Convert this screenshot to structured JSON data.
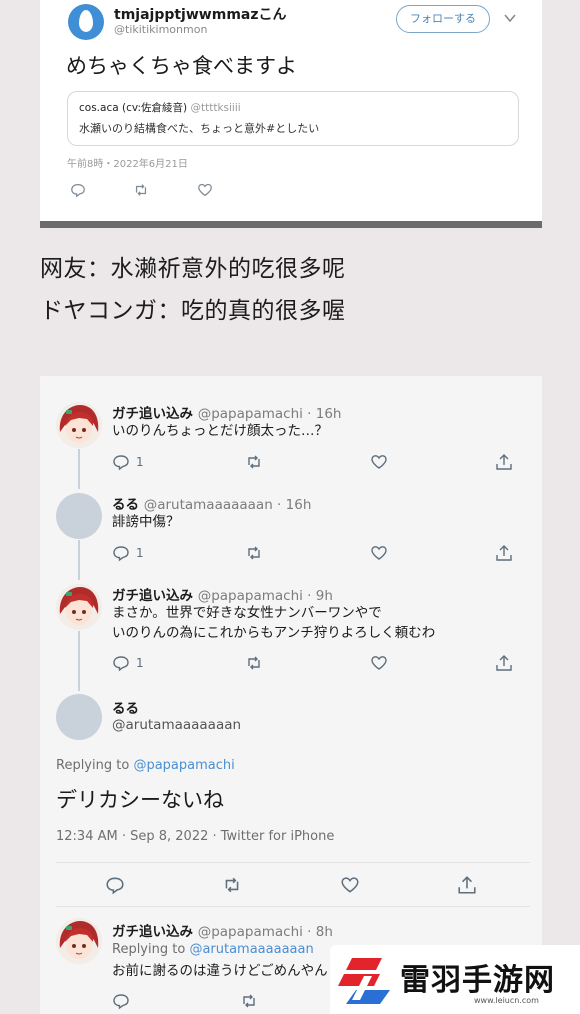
{
  "top_tweet": {
    "name": "tmjajpptjwwmmazこん",
    "handle": "@tikitikimonmon",
    "follow_label": "フォローする",
    "text": "めちゃくちゃ食べますよ",
    "quote": {
      "name": "cos.aca (cv:佐倉綾音)",
      "handle": "@ttttksiiii",
      "text": "水瀬いのり結構食べた、ちょっと意外#としたい"
    },
    "timestamp": "午前8時・2022年6月21日"
  },
  "captions": [
    "网友：水濑祈意外的吃很多呢",
    "ドヤコンガ：吃的真的很多喔"
  ],
  "thread": {
    "tweets": [
      {
        "name": "ガチ追い込み",
        "meta": "@papapamachi · 16h",
        "lines": [
          "いのりんちょっとだけ顔太った…？"
        ],
        "reply_count": "1"
      },
      {
        "name": "るる",
        "meta": "@arutamaaaaaaan · 16h",
        "lines": [
          "誹謗中傷？"
        ],
        "reply_count": "1"
      },
      {
        "name": "ガチ追い込み",
        "meta": "@papapamachi · 9h",
        "lines": [
          "まさか。世界で好きな女性ナンバーワンやで",
          "いのりんの為にこれからもアンチ狩りよろしく頼むわ"
        ],
        "reply_count": "1"
      }
    ],
    "main": {
      "name": "るる",
      "handle": "@arutamaaaaaaan",
      "replying_prefix": "Replying to",
      "replying_handle": "@papapamachi",
      "text": "デリカシーないね",
      "timestamp": "12:34 AM · Sep 8, 2022 · Twitter for iPhone"
    },
    "last": {
      "name": "ガチ追い込み",
      "meta": "@papapamachi · 8h",
      "replying_prefix": "Replying to",
      "replying_handle": "@arutamaaaaaaan",
      "text": "お前に謝るのは違うけどごめんやん"
    }
  },
  "watermark": {
    "title": "雷羽手游网",
    "url": "www.leiucn.com"
  },
  "colors": {
    "background": "#ece7e8",
    "link": "#4a8fd0",
    "follow": "#4b86b8",
    "watermark_red": "#e2242c",
    "watermark_blue": "#2a6fd6"
  }
}
